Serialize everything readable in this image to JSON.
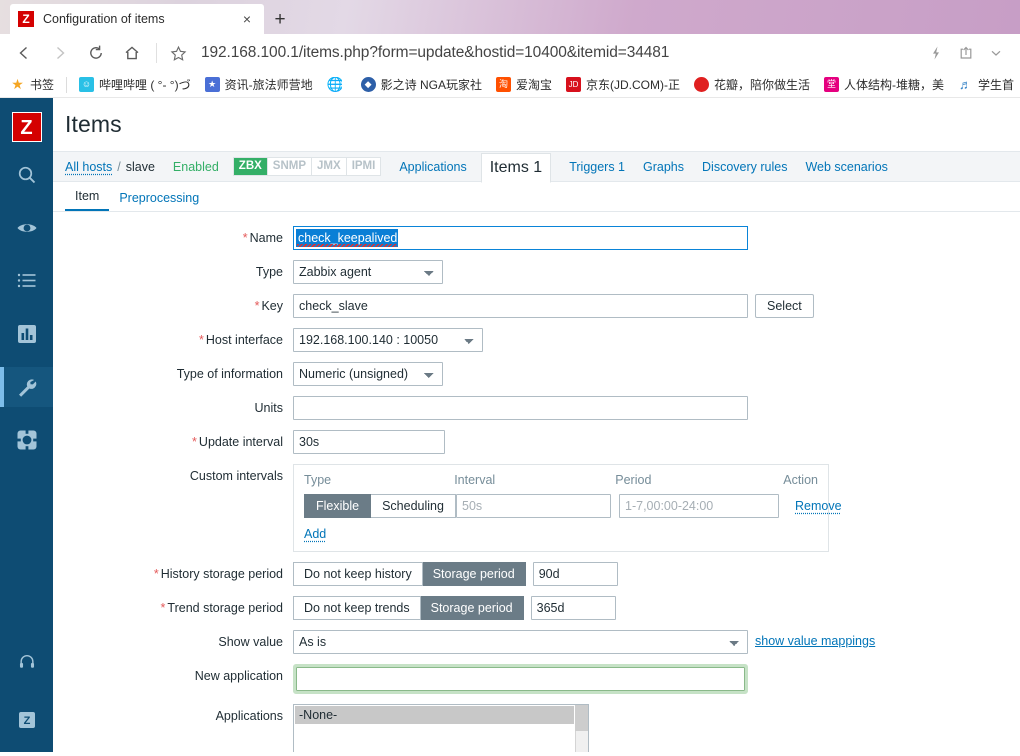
{
  "browser": {
    "tab": {
      "title": "Configuration of items",
      "favicon_letter": "Z",
      "close_label": "×"
    },
    "newtab_label": "+",
    "nav": {
      "back_icon": "back-arrow-icon",
      "forward_icon": "forward-arrow-icon",
      "reload_icon": "reload-icon",
      "home_icon": "home-icon",
      "star_icon": "star-icon",
      "url": "192.168.100.1/items.php?form=update&hostid=10400&itemid=34481",
      "reading_icon": "lightning-icon",
      "share_icon": "share-icon",
      "more_icon": "chevron-down-icon"
    },
    "bookmarks": [
      {
        "label": "书签",
        "icon": "star-icon",
        "color": "#f5a623"
      },
      {
        "label": "哔哩哔哩 ( °- °)づ",
        "icon": "bilibili-icon",
        "color": "#29c0e6"
      },
      {
        "label": "资讯-旅法师营地",
        "icon": "mtg-icon",
        "color": "#4a6fd6"
      },
      {
        "label": "",
        "icon": "globe-icon",
        "color": "#888888"
      },
      {
        "label": "影之诗 NGA玩家社",
        "icon": "shadowverse-icon",
        "color": "#2d5fa8"
      },
      {
        "label": "爱淘宝",
        "icon": "taobao-icon",
        "color": "#ff5000"
      },
      {
        "label": "京东(JD.COM)-正",
        "icon": "jd-icon",
        "color": "#d7101c"
      },
      {
        "label": "花瓣，陪你做生活",
        "icon": "huaban-icon",
        "color": "#e02020"
      },
      {
        "label": "人体结构-堆糖，美",
        "icon": "duitang-icon",
        "color": "#e5007f"
      },
      {
        "label": "学生首",
        "icon": "music-icon",
        "color": "#3a86c8"
      }
    ]
  },
  "sidebar": {
    "logo_letter": "Z",
    "items": [
      {
        "name": "search-icon",
        "label": "Search"
      },
      {
        "name": "monitoring-eye-icon",
        "label": "Monitoring"
      },
      {
        "name": "inventory-list-icon",
        "label": "Inventory"
      },
      {
        "name": "reports-chart-icon",
        "label": "Reports"
      },
      {
        "name": "configuration-wrench-icon",
        "label": "Configuration",
        "active": true
      },
      {
        "name": "administration-gear-icon",
        "label": "Administration"
      }
    ],
    "bottom_items": [
      {
        "name": "support-headset-icon",
        "label": "Support"
      },
      {
        "name": "zabbix-link-icon",
        "label": "Zabbix"
      }
    ]
  },
  "page": {
    "title": "Items"
  },
  "breadcrumb": {
    "all_hosts": "All hosts",
    "separator": "/",
    "host": "slave",
    "status": "Enabled",
    "protocols": [
      {
        "label": "ZBX",
        "active": true
      },
      {
        "label": "SNMP",
        "active": false
      },
      {
        "label": "JMX",
        "active": false
      },
      {
        "label": "IPMI",
        "active": false
      }
    ],
    "links": [
      {
        "label": "Applications",
        "current": false
      },
      {
        "label": "Items 1",
        "current": true
      },
      {
        "label": "Triggers 1",
        "current": false
      },
      {
        "label": "Graphs",
        "current": false
      },
      {
        "label": "Discovery rules",
        "current": false
      },
      {
        "label": "Web scenarios",
        "current": false
      }
    ]
  },
  "tabs": [
    {
      "label": "Item",
      "selected": true
    },
    {
      "label": "Preprocessing",
      "selected": false
    }
  ],
  "form": {
    "name": {
      "label": "Name",
      "required": true,
      "value": "check_keepalived",
      "selected": true
    },
    "type": {
      "label": "Type",
      "required": false,
      "value": "Zabbix agent"
    },
    "key": {
      "label": "Key",
      "required": true,
      "value": "check_slave",
      "button": "Select"
    },
    "host_interface": {
      "label": "Host interface",
      "required": true,
      "value": "192.168.100.140 : 10050"
    },
    "type_of_information": {
      "label": "Type of information",
      "required": false,
      "value": "Numeric (unsigned)"
    },
    "units": {
      "label": "Units",
      "required": false,
      "value": ""
    },
    "update_interval": {
      "label": "Update interval",
      "required": true,
      "value": "30s"
    },
    "custom_intervals": {
      "label": "Custom intervals",
      "headers": {
        "type": "Type",
        "interval": "Interval",
        "period": "Period",
        "action": "Action"
      },
      "row": {
        "flexible": "Flexible",
        "scheduling": "Scheduling",
        "selected": "Flexible",
        "interval_value": "",
        "interval_placeholder": "50s",
        "period_value": "",
        "period_placeholder": "1-7,00:00-24:00",
        "remove": "Remove"
      },
      "add": "Add"
    },
    "history": {
      "label": "History storage period",
      "required": true,
      "option_off": "Do not keep history",
      "option_on": "Storage period",
      "selected": "Storage period",
      "value": "90d"
    },
    "trends": {
      "label": "Trend storage period",
      "required": true,
      "option_off": "Do not keep trends",
      "option_on": "Storage period",
      "selected": "Storage period",
      "value": "365d"
    },
    "show_value": {
      "label": "Show value",
      "value": "As is",
      "link": "show value mappings"
    },
    "new_application": {
      "label": "New application",
      "value": "",
      "focused": true
    },
    "applications": {
      "label": "Applications",
      "options": [
        "-None-"
      ],
      "selected": "-None-"
    }
  },
  "colors": {
    "sidebar_bg": "#0e4c73",
    "sidebar_active": "#15567e",
    "accent_blue": "#0275b8",
    "zabbix_red": "#d40000",
    "green_enabled": "#34af67",
    "required_red": "#e45959",
    "segment_on": "#6b7c87",
    "selection_blue": "#0a7fd6"
  }
}
